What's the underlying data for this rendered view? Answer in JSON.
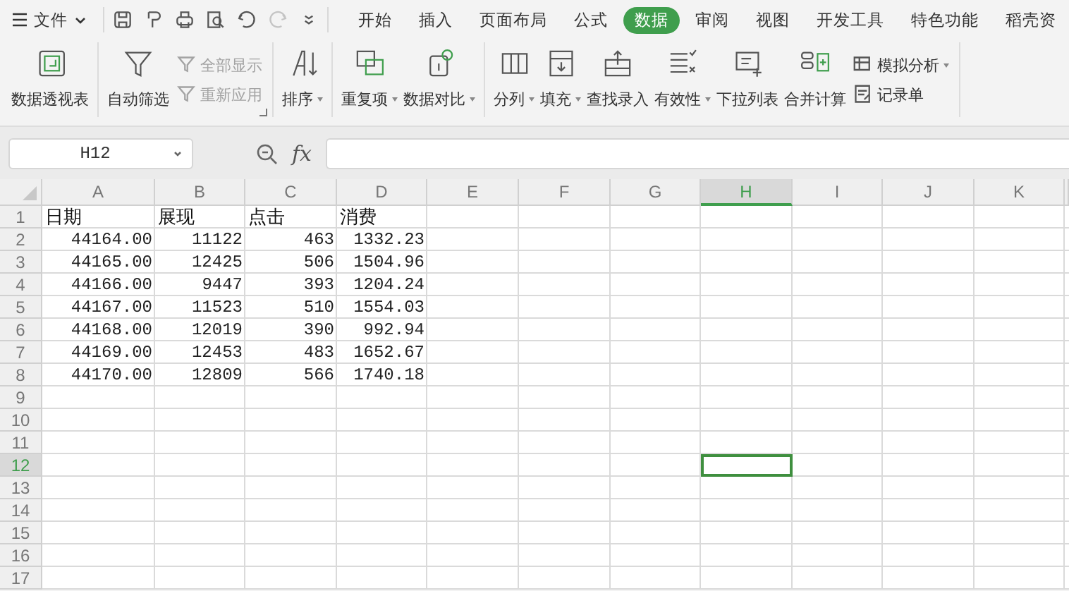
{
  "menu": {
    "label": "文件"
  },
  "quick_access": [
    {
      "disabled": false
    },
    {
      "disabled": false
    },
    {
      "disabled": false
    },
    {
      "disabled": false
    },
    {
      "disabled": false
    },
    {
      "disabled": true
    },
    {
      "disabled": false
    }
  ],
  "tabs": [
    {
      "label": "开始",
      "selected": false
    },
    {
      "label": "插入",
      "selected": false
    },
    {
      "label": "页面布局",
      "selected": false
    },
    {
      "label": "公式",
      "selected": false
    },
    {
      "label": "数据",
      "selected": true
    },
    {
      "label": "审阅",
      "selected": false
    },
    {
      "label": "视图",
      "selected": false
    },
    {
      "label": "开发工具",
      "selected": false
    },
    {
      "label": "特色功能",
      "selected": false
    },
    {
      "label": "稻壳资",
      "selected": false
    }
  ],
  "ribbon_groups": [
    {
      "tools": [
        {
          "kind": "large",
          "label": "数据透视表",
          "dropdown": false,
          "disabled": false
        }
      ]
    },
    {
      "launcher": true,
      "tools": [
        {
          "kind": "large",
          "label": "自动筛选",
          "dropdown": false,
          "disabled": false
        },
        {
          "kind": "small",
          "label": "全部显示",
          "dropdown": false,
          "disabled": true
        },
        {
          "kind": "small",
          "label": "重新应用",
          "dropdown": false,
          "disabled": true
        }
      ]
    },
    {
      "tools": [
        {
          "kind": "large",
          "label": "排序",
          "dropdown": true,
          "disabled": false
        }
      ]
    },
    {
      "tools": [
        {
          "kind": "large",
          "label": "重复项",
          "dropdown": true,
          "disabled": false
        },
        {
          "kind": "large",
          "label": "数据对比",
          "dropdown": true,
          "disabled": false
        }
      ]
    },
    {
      "tools": [
        {
          "kind": "large",
          "label": "分列",
          "dropdown": true,
          "disabled": false
        },
        {
          "kind": "large",
          "label": "填充",
          "dropdown": true,
          "disabled": false
        },
        {
          "kind": "large",
          "label": "查找录入",
          "dropdown": false,
          "disabled": false
        },
        {
          "kind": "large",
          "label": "有效性",
          "dropdown": true,
          "disabled": false
        },
        {
          "kind": "large",
          "label": "下拉列表",
          "dropdown": false,
          "disabled": false
        },
        {
          "kind": "large",
          "label": "合并计算",
          "dropdown": false,
          "disabled": false
        },
        {
          "kind": "small",
          "label": "模拟分析",
          "dropdown": true,
          "disabled": false
        },
        {
          "kind": "small",
          "label": "记录单",
          "dropdown": false,
          "disabled": false
        }
      ]
    }
  ],
  "name_box": {
    "value": "H12"
  },
  "formula_bar": {
    "function_label": "fx"
  },
  "columns": [
    {
      "label": "A",
      "selected": false
    },
    {
      "label": "B",
      "selected": false
    },
    {
      "label": "C",
      "selected": false
    },
    {
      "label": "D",
      "selected": false
    },
    {
      "label": "E",
      "selected": false
    },
    {
      "label": "F",
      "selected": false
    },
    {
      "label": "G",
      "selected": false
    },
    {
      "label": "H",
      "selected": true
    },
    {
      "label": "I",
      "selected": false
    },
    {
      "label": "J",
      "selected": false
    },
    {
      "label": "K",
      "selected": false
    }
  ],
  "rows": [
    {
      "label": "1",
      "selected": false,
      "cells": [
        {
          "value": "日期",
          "kind": "text"
        },
        {
          "value": "展现",
          "kind": "text"
        },
        {
          "value": "点击",
          "kind": "text"
        },
        {
          "value": "消费",
          "kind": "text"
        }
      ]
    },
    {
      "label": "2",
      "selected": false,
      "cells": [
        {
          "value": "44164.00",
          "kind": "number"
        },
        {
          "value": "11122",
          "kind": "number"
        },
        {
          "value": "463",
          "kind": "number"
        },
        {
          "value": "1332.23",
          "kind": "number"
        }
      ]
    },
    {
      "label": "3",
      "selected": false,
      "cells": [
        {
          "value": "44165.00",
          "kind": "number"
        },
        {
          "value": "12425",
          "kind": "number"
        },
        {
          "value": "506",
          "kind": "number"
        },
        {
          "value": "1504.96",
          "kind": "number"
        }
      ]
    },
    {
      "label": "4",
      "selected": false,
      "cells": [
        {
          "value": "44166.00",
          "kind": "number"
        },
        {
          "value": "9447",
          "kind": "number"
        },
        {
          "value": "393",
          "kind": "number"
        },
        {
          "value": "1204.24",
          "kind": "number"
        }
      ]
    },
    {
      "label": "5",
      "selected": false,
      "cells": [
        {
          "value": "44167.00",
          "kind": "number"
        },
        {
          "value": "11523",
          "kind": "number"
        },
        {
          "value": "510",
          "kind": "number"
        },
        {
          "value": "1554.03",
          "kind": "number"
        }
      ]
    },
    {
      "label": "6",
      "selected": false,
      "cells": [
        {
          "value": "44168.00",
          "kind": "number"
        },
        {
          "value": "12019",
          "kind": "number"
        },
        {
          "value": "390",
          "kind": "number"
        },
        {
          "value": "992.94",
          "kind": "number"
        }
      ]
    },
    {
      "label": "7",
      "selected": false,
      "cells": [
        {
          "value": "44169.00",
          "kind": "number"
        },
        {
          "value": "12453",
          "kind": "number"
        },
        {
          "value": "483",
          "kind": "number"
        },
        {
          "value": "1652.67",
          "kind": "number"
        }
      ]
    },
    {
      "label": "8",
      "selected": false,
      "cells": [
        {
          "value": "44170.00",
          "kind": "number"
        },
        {
          "value": "12809",
          "kind": "number"
        },
        {
          "value": "566",
          "kind": "number"
        },
        {
          "value": "1740.18",
          "kind": "number"
        }
      ]
    },
    {
      "label": "9",
      "selected": false
    },
    {
      "label": "10",
      "selected": false
    },
    {
      "label": "11",
      "selected": false
    },
    {
      "label": "12",
      "selected": true
    },
    {
      "label": "13",
      "selected": false
    },
    {
      "label": "14",
      "selected": false
    },
    {
      "label": "15",
      "selected": false
    },
    {
      "label": "16",
      "selected": false
    },
    {
      "label": "17",
      "selected": false
    }
  ]
}
